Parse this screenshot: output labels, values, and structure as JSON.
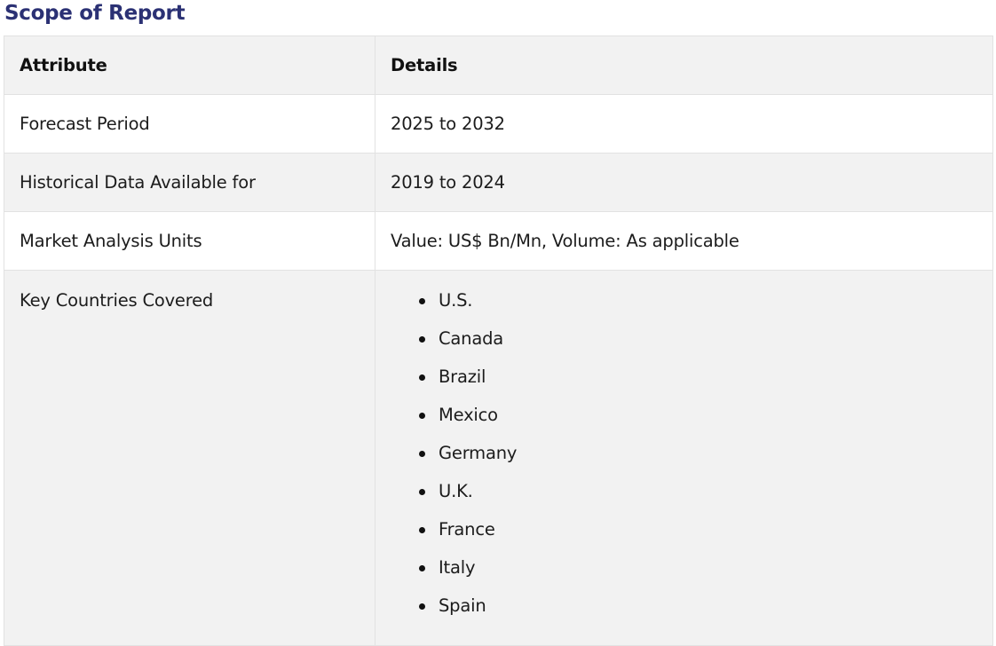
{
  "section": {
    "title": "Scope of Report"
  },
  "table": {
    "headers": [
      "Attribute",
      "Details"
    ],
    "rows": [
      {
        "attribute": "Forecast Period",
        "details": "2025 to 2032"
      },
      {
        "attribute": "Historical Data Available for",
        "details": "2019 to 2024"
      },
      {
        "attribute": "Market Analysis Units",
        "details": "Value: US$ Bn/Mn, Volume: As applicable"
      },
      {
        "attribute": "Key Countries Covered",
        "details_list": [
          "U.S.",
          "Canada",
          "Brazil",
          "Mexico",
          "Germany",
          "U.K.",
          "France",
          "Italy",
          "Spain"
        ]
      }
    ]
  }
}
